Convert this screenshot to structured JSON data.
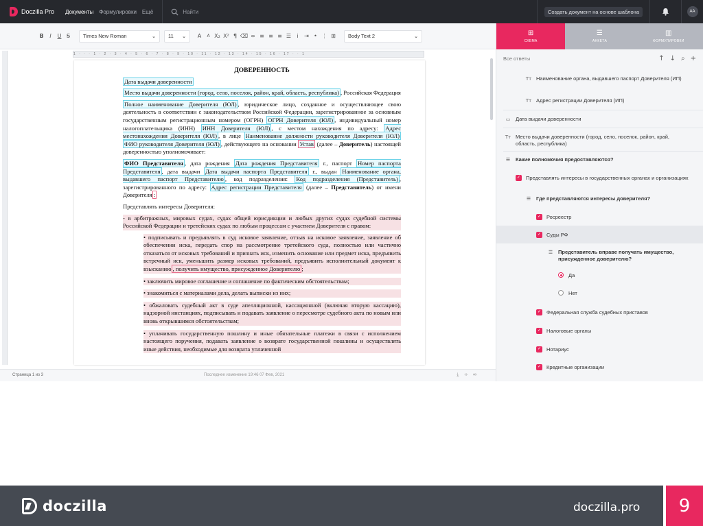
{
  "topbar": {
    "app_name": "Doczilla Pro",
    "nav": [
      "Документы",
      "Формулировки",
      "Ещё"
    ],
    "search_placeholder": "Найти",
    "create_button": "Создать документ на основе шаблона",
    "avatar_initials": "AA"
  },
  "toolbar": {
    "bold": "B",
    "italic": "I",
    "underline": "U",
    "strike": "S",
    "font": "Times New Roman",
    "size": "11",
    "style": "Body Text 2"
  },
  "ruler": "1 · · · 1 · 2 · 3 · 4 · 5 · 6 · 7 · 8 · 9 · 10 · 11 · 12 · 13 · 14 · 15 · 16 · 17 · · 1",
  "document": {
    "title": "ДОВЕРЕННОСТЬ",
    "date_field": "Дата выдачи доверенности",
    "place_prefix": "Место выдачи доверенности (город, село, поселок, район, край, область, республика)",
    "place_suffix": ", Российская Федерация",
    "p3a": "Полное наименование Доверителя (ЮЛ)",
    "p3b": ", юридическое лицо, созданное и осуществляющее свою деятельность в соответствии с законодательством Российской Федерации, зарегистрированное за основным государственным регистрационным номером (ОГРН)",
    "p3c": "ОГРН Доверителя (ЮЛ)",
    "p3d": ", индивидуальный номер налогоплательщика (ИНН)",
    "p3e": "ИНН Доверителя (ЮЛ)",
    "p3f": ", с местом нахождения по адресу:",
    "p3g": "Адрес местонахождения Доверителя (ЮЛ)",
    "p3h": ", в лице",
    "p3i": "Наименование должности руководителя Доверителя (ЮЛ)",
    "p3j": "ФИО руководителя Доверителя (ЮЛ)",
    "p3k": ", действующего на основании",
    "p3l": "Устав",
    "p3m": "(далее –",
    "p3n": "Доверитель",
    "p3o": ") настоящей доверенностью уполномочивает:",
    "p4a": "ФИО Представителя",
    "p4b": ", дата рождения",
    "p4c": "Дата рождения Представителя",
    "p4d": " г., паспорт",
    "p4e": "Номер паспорта Представителя",
    "p4f": ", дата выдачи",
    "p4g": "Дата выдачи паспорта Представителя",
    "p4h": " г., выдан",
    "p4i": "Наименование органа, выдавшего паспорт Представителю",
    "p4j": ", код подразделения:",
    "p4k": "Код подразделения (Представитель)",
    "p4l": ", зарегистрированного по адресу:",
    "p4m": "Адрес регистрации Представителя",
    "p4n": "(далее –",
    "p4o": "Представитель",
    "p4p": ") от имени Доверителя",
    "p4q": ":",
    "p5": "Представлять интересы Доверителя:",
    "p6": "- в арбитражных, мировых судах, судах общей юрисдикции и любых других судах судебной системы Российской Федерации и третейских судах по любым процессам с участием Доверителя с правом:",
    "b1a": "• подписывать и предъявлять в суд исковое заявление, отзыв на исковое заявление, заявление об обеспечении иска, передать спор на рассмотрение третейского суда, полностью или частично отказаться от исковых требований и признать иск, изменить основание или предмет иска, предъявить встречный иск, уменьшить размер исковых требований, предъявить исполнительный документ к взысканию",
    "b1b": ", получить имущество, присужденное Доверителю",
    "b1c": ";",
    "b2": "• заключить мировое соглашение и соглашение по фактическим обстоятельствам;",
    "b3": "• знакомиться с материалами дела, делать выписки из них;",
    "b4": "• обжаловать судебный акт в суде апелляционной, кассационной (включая вторую кассацию), надзорной инстанциях, подписывать и подавать заявление о пересмотре судебного акта по новым или вновь открывшимся обстоятельствам;",
    "b5": "• уплачивать государственную пошлину и иные обязательные платежи в связи с исполнением настоящего поручения, подавать заявление о возврате государственной пошлины и осуществлять иные действия, необходимые для возврата уплаченной"
  },
  "status": {
    "page": "Страница 1 из 3",
    "last_change": "Последнее изменение 19:46 07 Фев, 2021"
  },
  "panel": {
    "tabs": [
      "СХЕМА",
      "АНКЕТА",
      "ФОРМУЛИРОВКИ"
    ],
    "header": "Все ответы",
    "items": [
      "Наименование органа, выдавшего паспорт Доверителя (ИП)",
      "Адрес регистрации Доверителя (ИП)",
      "Дата выдачи доверенности",
      "Место выдачи доверенности (город, село, поселок, район, край, область, республика)",
      "Какие полномочия предоставляются?",
      "Представлять интересы в государственных органах и организациях",
      "Где представляются интересы доверителя?",
      "Росреестр",
      "Суды РФ",
      "Представитель вправе получать имущество, присужденное доверителю?",
      "Да",
      "Нет",
      "Федеральная служба судебных приставов",
      "Налоговые органы",
      "Нотариус",
      "Кредитные организации"
    ],
    "tt": "Tт"
  },
  "footer": {
    "brand": "doczilla",
    "site": "doczilla.pro",
    "slide_number": "9"
  },
  "colors": {
    "accent": "#e8285f",
    "topbar": "#26282d",
    "footer": "#454a52"
  }
}
